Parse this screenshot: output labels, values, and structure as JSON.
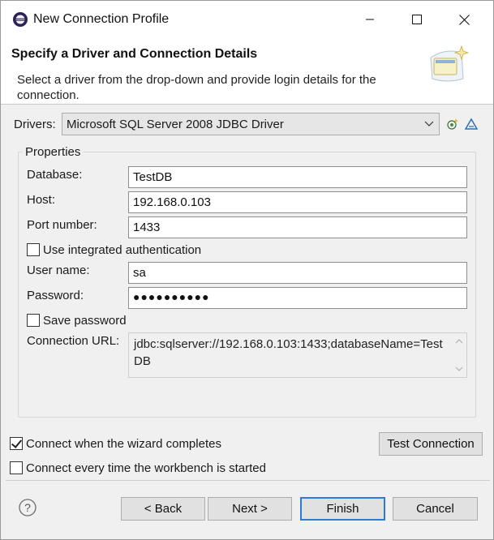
{
  "window": {
    "title": "New Connection Profile"
  },
  "header": {
    "title": "Specify a Driver and Connection Details",
    "description": "Select a driver from the drop-down and provide login details for the connection."
  },
  "drivers": {
    "label": "Drivers:",
    "selected": "Microsoft SQL Server 2008 JDBC Driver",
    "new_driver_icon": "new-driver-icon",
    "edit_driver_icon": "edit-driver-icon"
  },
  "properties": {
    "group_label": "Properties",
    "database_label": "Database:",
    "database_value": "TestDB",
    "host_label": "Host:",
    "host_value": "192.168.0.103",
    "port_label": "Port number:",
    "port_value": "1433",
    "integrated_auth_label": "Use integrated authentication",
    "integrated_auth_checked": false,
    "username_label": "User name:",
    "username_value": "sa",
    "password_label": "Password:",
    "password_value": "●●●●●●●●●●",
    "save_password_label": "Save password",
    "save_password_checked": false,
    "url_label": "Connection URL:",
    "url_value": "jdbc:sqlserver://192.168.0.103:1433;databaseName=TestDB"
  },
  "options": {
    "connect_when_complete_label": "Connect when the wizard completes",
    "connect_when_complete_checked": true,
    "connect_every_time_label": "Connect every time the workbench is started",
    "connect_every_time_checked": false,
    "test_connection_label": "Test Connection"
  },
  "footer": {
    "help_icon": "help-icon",
    "back_label": "< Back",
    "next_label": "Next >",
    "finish_label": "Finish",
    "cancel_label": "Cancel"
  },
  "colors": {
    "default_button_border": "#2f7ad3",
    "dialog_background": "#f0f0f0",
    "header_background": "#ffffff"
  }
}
